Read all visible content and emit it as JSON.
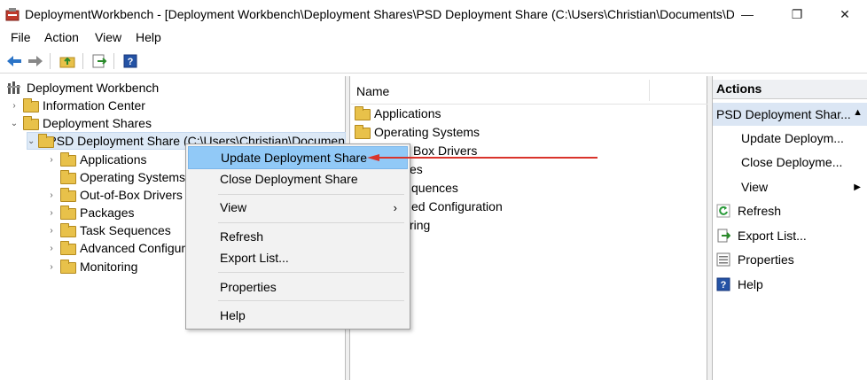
{
  "window": {
    "title": "DeploymentWorkbench - [Deployment Workbench\\Deployment Shares\\PSD Deployment Share (C:\\Users\\Christian\\Documents\\De...",
    "minimize_glyph": "—",
    "restore_glyph": "❐",
    "close_glyph": "✕"
  },
  "menubar": {
    "items": [
      "File",
      "Action",
      "View",
      "Help"
    ]
  },
  "tree": {
    "root": "Deployment Workbench",
    "info_center": "Information Center",
    "deployment_shares": "Deployment Shares",
    "psd_share": "PSD Deployment Share (C:\\Users\\Christian\\Documen",
    "children": [
      "Applications",
      "Operating Systems",
      "Out-of-Box Drivers",
      "Packages",
      "Task Sequences",
      "Advanced Configur",
      "Monitoring"
    ]
  },
  "list": {
    "header": "Name",
    "rows": [
      "Applications",
      "Operating Systems",
      "Box Drivers",
      "es",
      "quences",
      "ed Configuration",
      "ring"
    ]
  },
  "actions": {
    "header": "Actions",
    "section": "PSD Deployment Shar...",
    "items": [
      "Update Deploym...",
      "Close Deployme...",
      "View",
      "Refresh",
      "Export List...",
      "Properties",
      "Help"
    ]
  },
  "context_menu": {
    "items": [
      "Update Deployment Share",
      "Close Deployment Share",
      "View",
      "Refresh",
      "Export List...",
      "Properties",
      "Help"
    ],
    "highlighted": "Update Deployment Share"
  },
  "colors": {
    "highlight": "#91c9f7",
    "selection": "#dde9f6",
    "arrow": "#d9342b",
    "folder": "#e8c14a"
  }
}
